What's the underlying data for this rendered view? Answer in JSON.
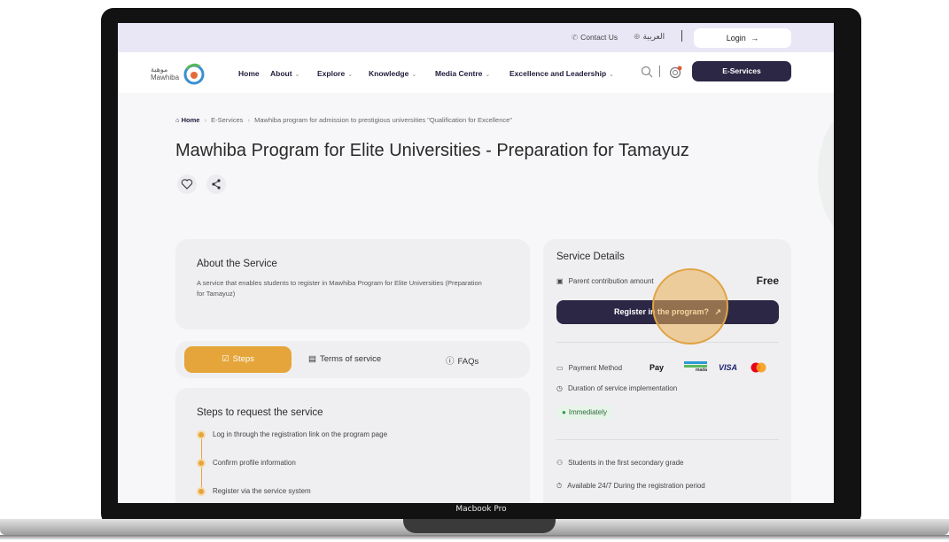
{
  "device": {
    "label": "Macbook Pro"
  },
  "topbar": {
    "contact": "Contact Us",
    "language": "العربية",
    "login": "Login"
  },
  "logo": {
    "arabic": "موهبة",
    "latin": "Mawhiba"
  },
  "nav": {
    "items": [
      "Home",
      "About",
      "Explore",
      "Knowledge",
      "Media Centre",
      "Excellence and Leadership"
    ],
    "eservices": "E-Services"
  },
  "breadcrumb": {
    "home": "Home",
    "section": "E-Services",
    "current": "Mawhiba program for admission to prestigious universities \"Qualification for Excellence\""
  },
  "page": {
    "title": "Mawhiba Program for Elite Universities - Preparation for Tamayuz"
  },
  "about": {
    "heading": "About the Service",
    "text": "A service that enables students to register in Mawhiba Program for Elite Universities (Preparation for Tamayuz)"
  },
  "tabs": {
    "steps": "Steps",
    "terms": "Terms of service",
    "faqs": "FAQs"
  },
  "steps": {
    "heading": "Steps to request the service",
    "items": [
      "Log in through the registration link on the program page",
      "Confirm profile information",
      "Register via the service system"
    ]
  },
  "service_details": {
    "heading": "Service Details",
    "contribution_label": "Parent contribution amount",
    "contribution_value": "Free",
    "register_button": "Register in the program?",
    "payment_label": "Payment Method",
    "payment_methods": [
      "Pay",
      "mada",
      "VISA"
    ],
    "duration_label": "Duration of service implementation",
    "duration_value": "Immediately",
    "audience": "Students in the first secondary grade",
    "availability": "Available 24/7 During the registration period"
  },
  "colors": {
    "accent": "#e5a53a",
    "primary": "#2c2745",
    "topbar": "#e9e6f6"
  }
}
